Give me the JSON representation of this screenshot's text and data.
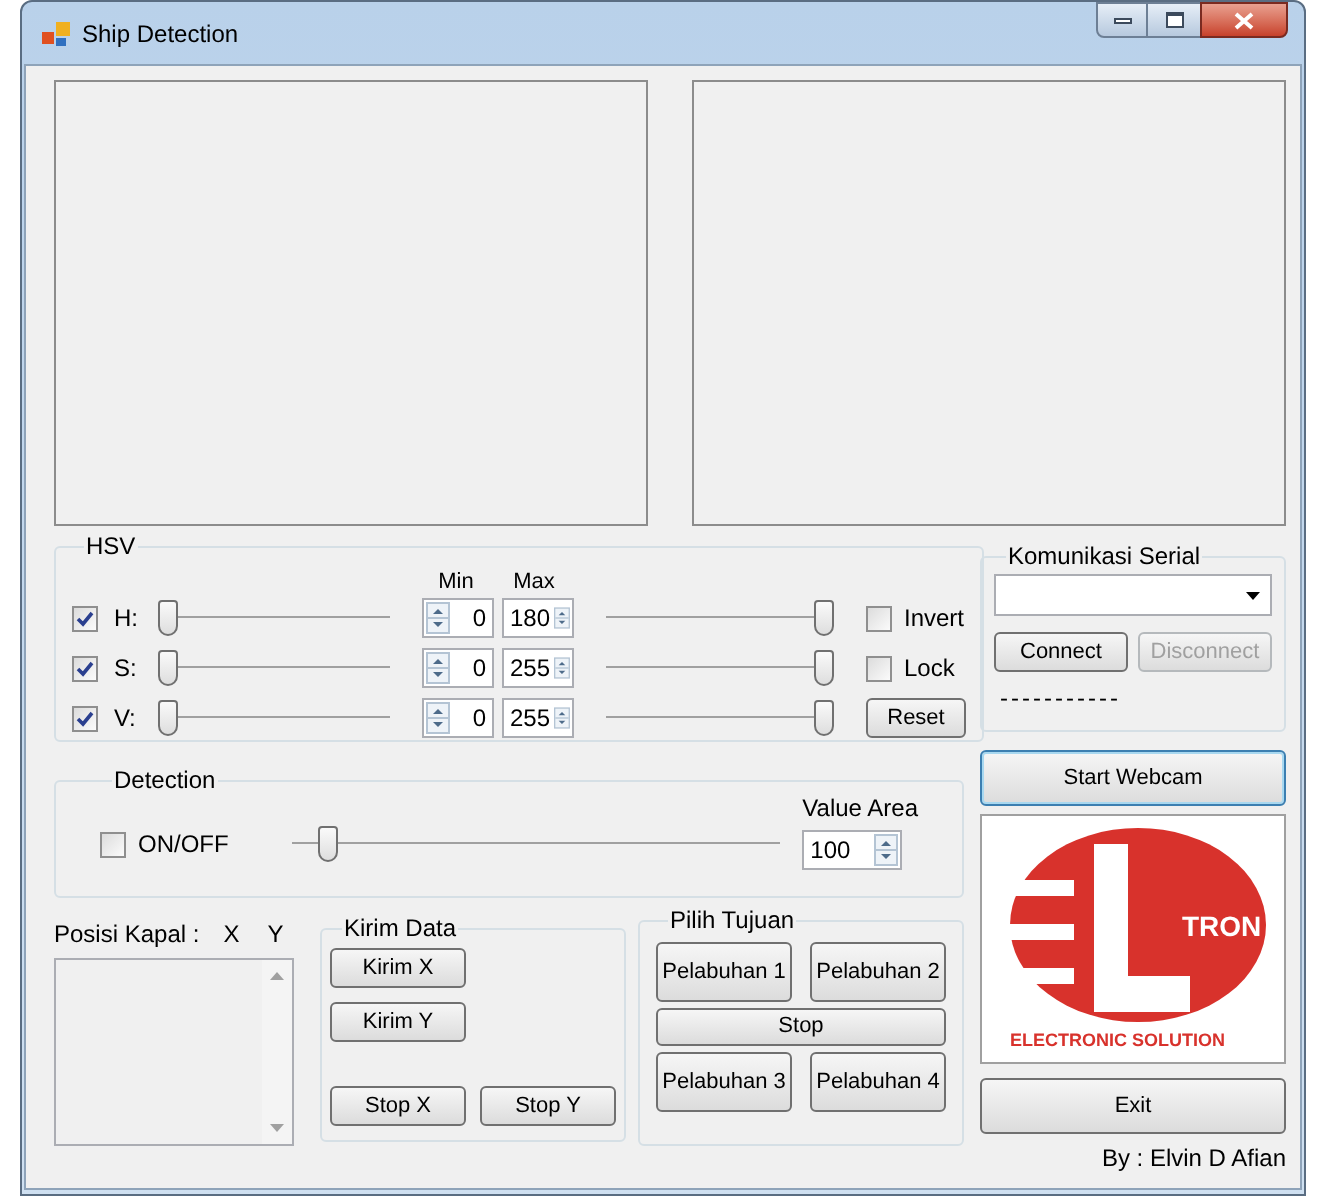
{
  "window": {
    "title": "Ship Detection"
  },
  "hsv": {
    "title": "HSV",
    "min_header": "Min",
    "max_header": "Max",
    "rows": [
      {
        "enabled": true,
        "label": "H:",
        "min_slider": {
          "level": 0
        },
        "min_value": "0",
        "max_value": "180",
        "max_slider": {
          "level": 1
        }
      },
      {
        "enabled": true,
        "label": "S:",
        "min_slider": {
          "level": 0
        },
        "min_value": "0",
        "max_value": "255",
        "max_slider": {
          "level": 1
        }
      },
      {
        "enabled": true,
        "label": "V:",
        "min_slider": {
          "level": 0
        },
        "min_value": "0",
        "max_value": "255",
        "max_slider": {
          "level": 1
        }
      }
    ],
    "invert": {
      "label": "Invert",
      "checked": false
    },
    "lock": {
      "label": "Lock",
      "checked": false
    },
    "reset": "Reset"
  },
  "serial": {
    "title": "Komunikasi Serial",
    "connect": {
      "label": "Connect",
      "disabled": false
    },
    "disconnect": {
      "label": "Disconnect",
      "disabled": true
    },
    "status": "-----------"
  },
  "start_webcam": {
    "label": "Start Webcam",
    "focused": true
  },
  "detection": {
    "title": "Detection",
    "toggle": {
      "label": "ON/OFF",
      "checked": false
    },
    "slider": {
      "level": 0.07
    },
    "value_area": {
      "label": "Value Area",
      "value": "100"
    }
  },
  "position": {
    "label": "Posisi Kapal :",
    "x": "X",
    "y": "Y"
  },
  "send": {
    "title": "Kirim Data",
    "buttons": [
      "Kirim X",
      "Kirim Y"
    ],
    "stop_buttons": [
      "Stop X",
      "Stop Y"
    ]
  },
  "destination": {
    "title": "Pilih Tujuan",
    "ports": [
      "Pelabuhan 1",
      "Pelabuhan 2",
      "Pelabuhan 3",
      "Pelabuhan 4"
    ],
    "stop": "Stop"
  },
  "logo": {
    "mark": "TRON",
    "tagline": "ELECTRONIC SOLUTION"
  },
  "exit": "Exit",
  "credit": "By : Elvin D Afian"
}
